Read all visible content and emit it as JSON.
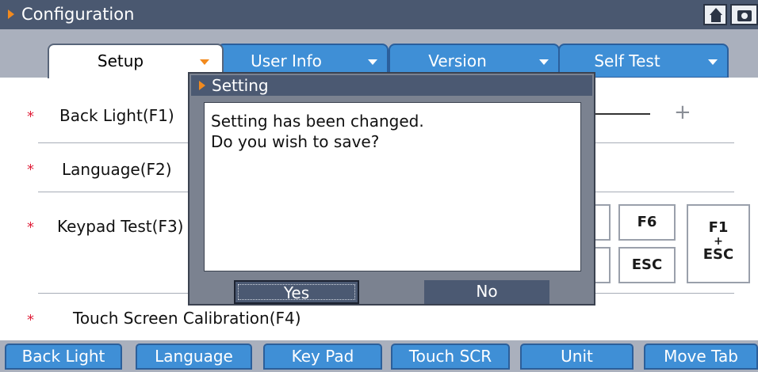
{
  "window": {
    "title": "Configuration",
    "buttons": [
      "home-icon",
      "camera-icon"
    ]
  },
  "tabs": [
    {
      "label": "Setup",
      "active": true
    },
    {
      "label": "User Info",
      "active": false
    },
    {
      "label": "Version",
      "active": false
    },
    {
      "label": "Self Test",
      "active": false
    }
  ],
  "settings": {
    "rows": [
      {
        "marker": "*",
        "label": "Back Light(F1)"
      },
      {
        "marker": "*",
        "label": "Language(F2)"
      },
      {
        "marker": "*",
        "label": "Keypad Test(F3)"
      },
      {
        "marker": "*",
        "label": "Touch Screen Calibration(F4)"
      }
    ],
    "backlight_plus": "+",
    "keys": {
      "f6": "F6",
      "esc": "ESC",
      "f1": "F1",
      "plus": "+",
      "esc2": "ESC"
    }
  },
  "dialog": {
    "title": "Setting",
    "message_line1": "Setting has been changed.",
    "message_line2": "Do you wish to save?",
    "yes_label": "Yes",
    "no_label": "No"
  },
  "toolbar": [
    {
      "label": "Back Light"
    },
    {
      "label": "Language"
    },
    {
      "label": "Key Pad"
    },
    {
      "label": "Touch SCR"
    },
    {
      "label": "Unit"
    },
    {
      "label": "Move Tab"
    }
  ],
  "colors": {
    "titlebar": "#4a5870",
    "accent_orange": "#f28a1e",
    "tab_blue": "#3f8fd6",
    "strip_gray": "#aab0bd",
    "marker_red": "#e0203a"
  }
}
